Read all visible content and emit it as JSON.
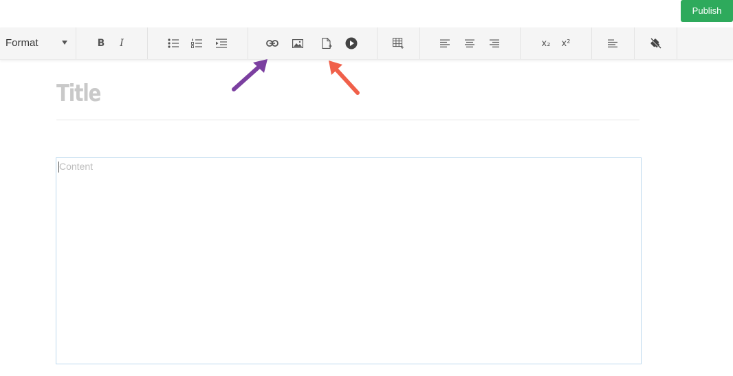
{
  "header": {
    "publish_label": "Publish"
  },
  "toolbar": {
    "format_label": "Format",
    "bold_label": "B",
    "italic_label": "I",
    "subscript_label": "x₂",
    "superscript_label": "x²"
  },
  "editor": {
    "title_placeholder": "Title",
    "content_placeholder": "Content"
  },
  "colors": {
    "publish": "#2eaa5c",
    "arrow_purple": "#7b3fa0",
    "arrow_red": "#f0604a"
  },
  "icons": {
    "bold": "bold-icon",
    "italic": "italic-icon",
    "bullet_list": "bullet-list-icon",
    "numbered_list": "numbered-list-icon",
    "indent": "indent-icon",
    "link": "link-icon",
    "image": "image-icon",
    "file": "file-icon",
    "video": "video-icon",
    "table": "table-icon",
    "align_left": "align-left-icon",
    "align_center": "align-center-icon",
    "align_right": "align-right-icon",
    "subscript": "subscript-icon",
    "superscript": "superscript-icon",
    "paragraph": "paragraph-icon",
    "clear_format": "clear-format-icon"
  }
}
